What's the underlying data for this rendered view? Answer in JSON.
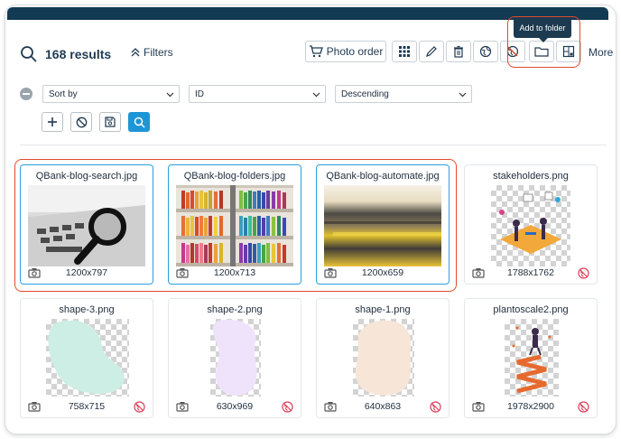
{
  "header": {
    "results_count": "168 results",
    "filters_label": "Filters",
    "photo_order_label": "Photo order",
    "more_label": "More",
    "tooltip": "Add to folder"
  },
  "sort": {
    "field1": "Sort by",
    "field2": "ID",
    "field3": "Descending"
  },
  "icons": {
    "toolbar": [
      "grid-icon",
      "pencil-icon",
      "trash-icon",
      "globe-icon",
      "globe-off-icon",
      "folder-icon",
      "layout-icon"
    ],
    "actions": [
      "plus-icon",
      "block-icon",
      "save-icon",
      "search-icon"
    ]
  },
  "colors": {
    "accent": "#1e96d6",
    "highlight": "#e14a2e",
    "topbar": "#123a52",
    "selected_border": "#2aa0dc"
  },
  "cards": [
    {
      "name": "QBank-blog-search.jpg",
      "dims": "1200x797",
      "selected": true
    },
    {
      "name": "QBank-blog-folders.jpg",
      "dims": "1200x713",
      "selected": true
    },
    {
      "name": "QBank-blog-automate.jpg",
      "dims": "1200x659",
      "selected": true
    },
    {
      "name": "stakeholders.png",
      "dims": "1788x1762",
      "selected": false
    },
    {
      "name": "shape-3.png",
      "dims": "758x715",
      "selected": false
    },
    {
      "name": "shape-2.png",
      "dims": "630x969",
      "selected": false
    },
    {
      "name": "shape-1.png",
      "dims": "640x863",
      "selected": false
    },
    {
      "name": "plantoscale2.png",
      "dims": "1978x2900",
      "selected": false
    }
  ]
}
